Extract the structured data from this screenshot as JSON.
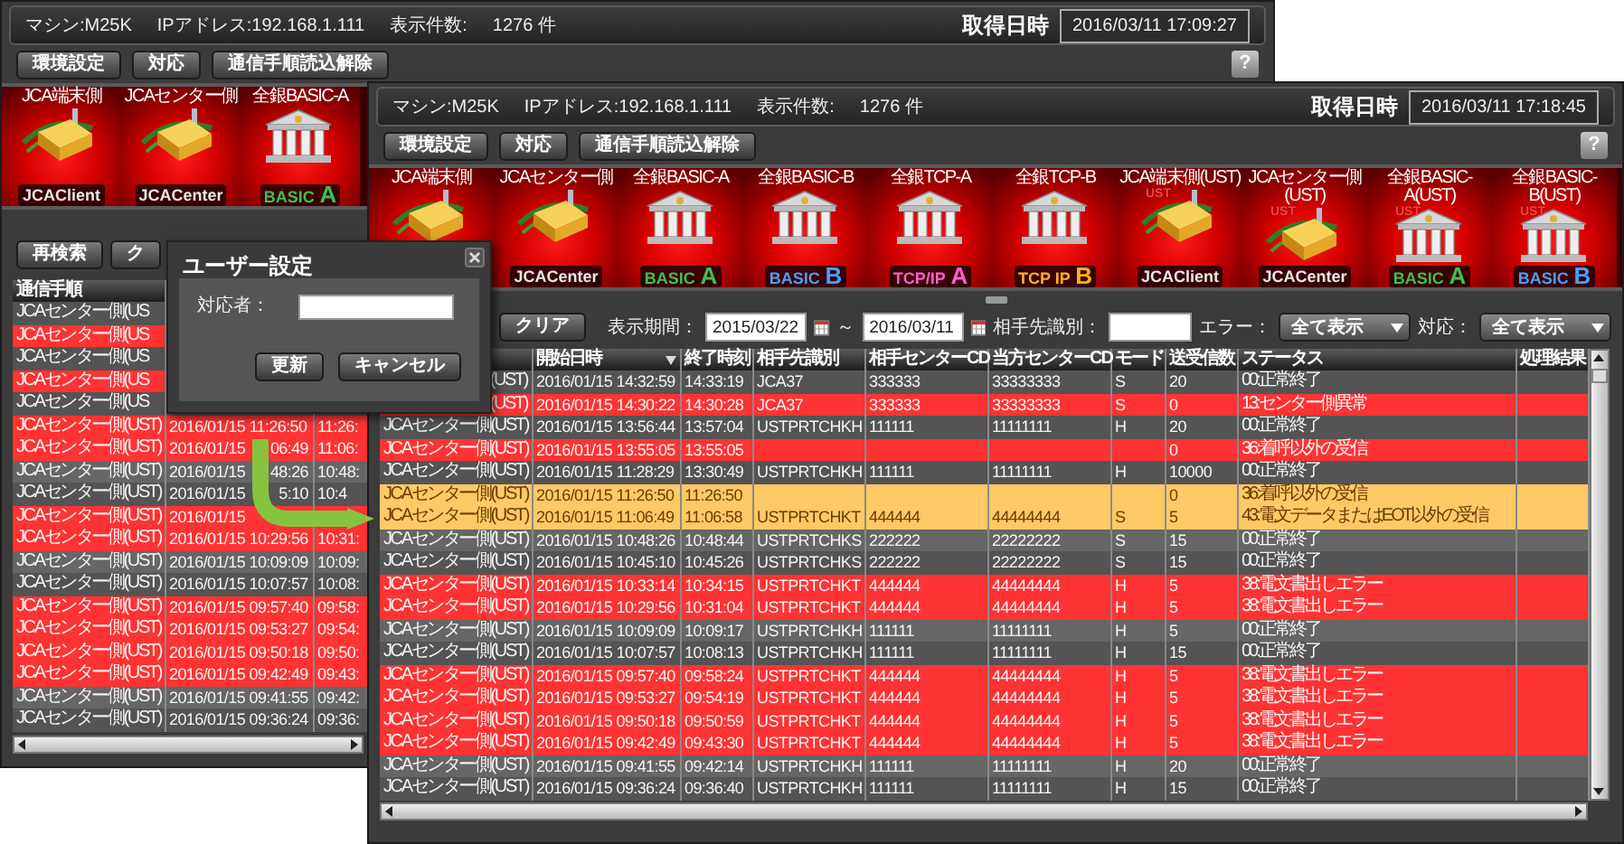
{
  "back_window": {
    "header": {
      "machine": "マシン:M25K",
      "ip": "IPアドレス:192.168.1.111",
      "count_label": "表示件数:",
      "count": "1276 件",
      "time_label": "取得日時",
      "time": "2016/03/11 17:09:27"
    },
    "toolbar": {
      "buttons": [
        "環境設定",
        "対応",
        "通信手順読込解除"
      ],
      "help": "?"
    },
    "icons": [
      {
        "label": "JCA端末側",
        "kind": "terminal",
        "logo": {
          "text": "JCAClient",
          "color": "#e6e6e6"
        }
      },
      {
        "label": "JCAセンター側",
        "kind": "terminal",
        "logo": {
          "text": "JCACenter",
          "color": "#e6e6e6"
        }
      },
      {
        "label": "全銀BASIC-A",
        "kind": "bank",
        "logo": {
          "text": "BASIC",
          "color": "#3fbf50",
          "letter": "A"
        }
      }
    ],
    "search_buttons": [
      "再検索",
      "ク"
    ],
    "table": {
      "columns": [
        "通信手順"
      ],
      "rows": [
        {
          "color": "#545454",
          "protocol": "JCAセンター側(US"
        },
        {
          "color": "#ff3333",
          "protocol": "JCAセンター側(US"
        },
        {
          "color": "#545454",
          "protocol": "JCAセンター側(US"
        },
        {
          "color": "#ff3333",
          "protocol": "JCAセンター側(US"
        },
        {
          "color": "#545454",
          "protocol": "JCAセンター側(US"
        },
        {
          "color": "#ff3333",
          "protocol": "JCAセンター側(UST)",
          "start": "2016/01/15 11:26:50",
          "end": "11:26:"
        },
        {
          "color": "#ff3333",
          "protocol": "JCAセンター側(UST)",
          "start": "2016/01/15",
          "start_tail": "06:49",
          "end": "11:06:"
        },
        {
          "color": "#666666",
          "protocol": "JCAセンター側(UST)",
          "start": "2016/01/15",
          "start_tail": "48:26",
          "end": "10:48:"
        },
        {
          "color": "#545454",
          "protocol": "JCAセンター側(UST)",
          "start": "2016/01/15",
          "start_tail": "5:10",
          "end": "10:4"
        },
        {
          "color": "#ff3333",
          "protocol": "JCAセンター側(UST)",
          "start": "2016/01/15"
        },
        {
          "color": "#ff3333",
          "protocol": "JCAセンター側(UST)",
          "start": "2016/01/15 10:29:56",
          "end": "10:31:"
        },
        {
          "color": "#666666",
          "protocol": "JCAセンター側(UST)",
          "start": "2016/01/15 10:09:09",
          "end": "10:09:"
        },
        {
          "color": "#545454",
          "protocol": "JCAセンター側(UST)",
          "start": "2016/01/15 10:07:57",
          "end": "10:08:"
        },
        {
          "color": "#ff3333",
          "protocol": "JCAセンター側(UST)",
          "start": "2016/01/15 09:57:40",
          "end": "09:58:"
        },
        {
          "color": "#ff3333",
          "protocol": "JCAセンター側(UST)",
          "start": "2016/01/15 09:53:27",
          "end": "09:54:"
        },
        {
          "color": "#ff3333",
          "protocol": "JCAセンター側(UST)",
          "start": "2016/01/15 09:50:18",
          "end": "09:50:"
        },
        {
          "color": "#ff3333",
          "protocol": "JCAセンター側(UST)",
          "start": "2016/01/15 09:42:49",
          "end": "09:43:"
        },
        {
          "color": "#666666",
          "protocol": "JCAセンター側(UST)",
          "start": "2016/01/15 09:41:55",
          "end": "09:42:"
        },
        {
          "color": "#545454",
          "protocol": "JCAセンター側(UST)",
          "start": "2016/01/15 09:36:24",
          "end": "09:36:"
        }
      ]
    }
  },
  "front_window": {
    "header": {
      "machine": "マシン:M25K",
      "ip": "IPアドレス:192.168.1.111",
      "count_label": "表示件数:",
      "count": "1276 件",
      "time_label": "取得日時",
      "time": "2016/03/11 17:18:45"
    },
    "toolbar": {
      "buttons": [
        "環境設定",
        "対応",
        "通信手順読込解除"
      ],
      "help": "?"
    },
    "icons": [
      {
        "label": "JCA端末側",
        "kind": "terminal"
      },
      {
        "label": "JCAセンター側",
        "kind": "terminal",
        "logo": {
          "text": "JCACenter",
          "color": "#e6e6e6"
        }
      },
      {
        "label": "全銀BASIC-A",
        "kind": "bank",
        "logo": {
          "text": "BASIC",
          "color": "#3fbf50",
          "letter": "A"
        }
      },
      {
        "label": "全銀BASIC-B",
        "kind": "bank",
        "logo": {
          "text": "BASIC",
          "color": "#4a9cff",
          "letter": "B"
        }
      },
      {
        "label": "全銀TCP-A",
        "kind": "bank",
        "logo": {
          "text": "TCP/IP",
          "color": "#ff5ccf",
          "letter": "A"
        }
      },
      {
        "label": "全銀TCP-B",
        "kind": "bank",
        "logo": {
          "text": "TCP IP",
          "color": "#ffb020",
          "letter": "B"
        }
      },
      {
        "label": "JCA端末側(UST)",
        "kind": "terminal",
        "badge": "UST",
        "logo": {
          "text": "JCAClient",
          "color": "#e6e6e6"
        }
      },
      {
        "label": "JCAセンター側(UST)",
        "kind": "terminal",
        "badge": "UST",
        "logo": {
          "text": "JCACenter",
          "color": "#e6e6e6"
        }
      },
      {
        "label": "全銀BASIC-A(UST)",
        "kind": "bank",
        "badge": "UST",
        "logo": {
          "text": "BASIC",
          "color": "#3fbf50",
          "letter": "A"
        }
      },
      {
        "label": "全銀BASIC-B(UST)",
        "kind": "bank",
        "badge": "UST",
        "logo": {
          "text": "BASIC",
          "color": "#4a9cff",
          "letter": "B"
        }
      }
    ],
    "filter": {
      "clear": "クリア",
      "period_label": "表示期間：",
      "from": "2015/03/22",
      "separator": "～",
      "to": "2016/03/11",
      "partner_label": "相手先識別：",
      "error_label": "エラー：",
      "error_value": "全て表示",
      "response_label": "対応：",
      "response_value": "全て表示"
    },
    "table": {
      "columns": [
        {
          "label": "開始日時",
          "sorted": true
        },
        {
          "label": "終了時刻"
        },
        {
          "label": "相手先識別"
        },
        {
          "label": "相手センターCD"
        },
        {
          "label": "当方センターCD"
        },
        {
          "label": "モード"
        },
        {
          "label": "送受信数"
        },
        {
          "label": "ステータス"
        },
        {
          "label": "処理結果"
        }
      ],
      "rows": [
        {
          "color": "#545454",
          "protocol": "(UST)",
          "start": "2016/01/15 14:32:59",
          "end": "14:33:19",
          "partner": "JCA37",
          "partner_cd": "333333",
          "own_cd": "33333333",
          "mode": "S",
          "count": "20",
          "status": "00:正常終了"
        },
        {
          "color": "#ff3333",
          "protocol": "(UST)",
          "start": "2016/01/15 14:30:22",
          "end": "14:30:28",
          "partner": "JCA37",
          "partner_cd": "333333",
          "own_cd": "33333333",
          "mode": "S",
          "count": "0",
          "status": "13:センター側異常"
        },
        {
          "color": "#545454",
          "protocol": "JCAセンター側(UST)",
          "start": "2016/01/15 13:56:44",
          "end": "13:57:04",
          "partner": "USTPRTCHKH",
          "partner_cd": "111111",
          "own_cd": "11111111",
          "mode": "H",
          "count": "20",
          "status": "00:正常終了"
        },
        {
          "color": "#ff3333",
          "protocol": "JCAセンター側(UST)",
          "start": "2016/01/15 13:55:05",
          "end": "13:55:05",
          "count": "0",
          "status": "36:着呼以外の受信"
        },
        {
          "color": "#545454",
          "protocol": "JCAセンター側(UST)",
          "start": "2016/01/15 11:28:29",
          "end": "13:30:49",
          "partner": "USTPRTCHKH",
          "partner_cd": "111111",
          "own_cd": "11111111",
          "mode": "H",
          "count": "10000",
          "status": "00:正常終了"
        },
        {
          "color": "#ffc966",
          "protocol": "JCAセンター側(UST)",
          "start": "2016/01/15 11:26:50",
          "end": "11:26:50",
          "count": "0",
          "status": "36:着呼以外の受信"
        },
        {
          "color": "#ffc966",
          "protocol": "JCAセンター側(UST)",
          "start": "2016/01/15 11:06:49",
          "end": "11:06:58",
          "partner": "USTPRTCHKT",
          "partner_cd": "444444",
          "own_cd": "44444444",
          "mode": "S",
          "count": "5",
          "status": "43:電文データまたはEOT以外の受信"
        },
        {
          "color": "#666666",
          "protocol": "JCAセンター側(UST)",
          "start": "2016/01/15 10:48:26",
          "end": "10:48:44",
          "partner": "USTPRTCHKS",
          "partner_cd": "222222",
          "own_cd": "22222222",
          "mode": "S",
          "count": "15",
          "status": "00:正常終了"
        },
        {
          "color": "#545454",
          "protocol": "JCAセンター側(UST)",
          "start": "2016/01/15 10:45:10",
          "end": "10:45:26",
          "partner": "USTPRTCHKS",
          "partner_cd": "222222",
          "own_cd": "22222222",
          "mode": "S",
          "count": "15",
          "status": "00:正常終了"
        },
        {
          "color": "#ff3333",
          "protocol": "JCAセンター側(UST)",
          "start": "2016/01/15 10:33:14",
          "end": "10:34:15",
          "partner": "USTPRTCHKT",
          "partner_cd": "444444",
          "own_cd": "44444444",
          "mode": "H",
          "count": "5",
          "status": "38:電文書出しエラー"
        },
        {
          "color": "#ff3333",
          "protocol": "JCAセンター側(UST)",
          "start": "2016/01/15 10:29:56",
          "end": "10:31:04",
          "partner": "USTPRTCHKT",
          "partner_cd": "444444",
          "own_cd": "44444444",
          "mode": "H",
          "count": "5",
          "status": "38:電文書出しエラー"
        },
        {
          "color": "#666666",
          "protocol": "JCAセンター側(UST)",
          "start": "2016/01/15 10:09:09",
          "end": "10:09:17",
          "partner": "USTPRTCHKH",
          "partner_cd": "111111",
          "own_cd": "11111111",
          "mode": "H",
          "count": "5",
          "status": "00:正常終了"
        },
        {
          "color": "#545454",
          "protocol": "JCAセンター側(UST)",
          "start": "2016/01/15 10:07:57",
          "end": "10:08:13",
          "partner": "USTPRTCHKH",
          "partner_cd": "111111",
          "own_cd": "11111111",
          "mode": "H",
          "count": "15",
          "status": "00:正常終了"
        },
        {
          "color": "#ff3333",
          "protocol": "JCAセンター側(UST)",
          "start": "2016/01/15 09:57:40",
          "end": "09:58:24",
          "partner": "USTPRTCHKT",
          "partner_cd": "444444",
          "own_cd": "44444444",
          "mode": "H",
          "count": "5",
          "status": "38:電文書出しエラー"
        },
        {
          "color": "#ff3333",
          "protocol": "JCAセンター側(UST)",
          "start": "2016/01/15 09:53:27",
          "end": "09:54:19",
          "partner": "USTPRTCHKT",
          "partner_cd": "444444",
          "own_cd": "44444444",
          "mode": "H",
          "count": "5",
          "status": "38:電文書出しエラー"
        },
        {
          "color": "#ff3333",
          "protocol": "JCAセンター側(UST)",
          "start": "2016/01/15 09:50:18",
          "end": "09:50:59",
          "partner": "USTPRTCHKT",
          "partner_cd": "444444",
          "own_cd": "44444444",
          "mode": "H",
          "count": "5",
          "status": "38:電文書出しエラー"
        },
        {
          "color": "#ff3333",
          "protocol": "JCAセンター側(UST)",
          "start": "2016/01/15 09:42:49",
          "end": "09:43:30",
          "partner": "USTPRTCHKT",
          "partner_cd": "444444",
          "own_cd": "44444444",
          "mode": "H",
          "count": "5",
          "status": "38:電文書出しエラー"
        },
        {
          "color": "#666666",
          "protocol": "JCAセンター側(UST)",
          "start": "2016/01/15 09:41:55",
          "end": "09:42:14",
          "partner": "USTPRTCHKH",
          "partner_cd": "111111",
          "own_cd": "11111111",
          "mode": "H",
          "count": "20",
          "status": "00:正常終了"
        },
        {
          "color": "#545454",
          "protocol": "JCAセンター側(UST)",
          "start": "2016/01/15 09:36:24",
          "end": "09:36:40",
          "partner": "USTPRTCHKH",
          "partner_cd": "111111",
          "own_cd": "11111111",
          "mode": "H",
          "count": "15",
          "status": "00:正常終了"
        }
      ]
    }
  },
  "dialog": {
    "title": "ユーザー設定",
    "field_label": "対応者：",
    "buttons": [
      "更新",
      "キャンセル"
    ]
  }
}
